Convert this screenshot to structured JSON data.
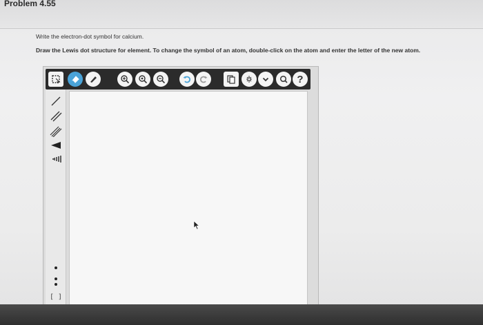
{
  "header": {
    "title": "Problem 4.55"
  },
  "question": {
    "line1": "Write the electron-dot symbol for calcium.",
    "line2": "Draw the Lewis dot structure for element. To change the symbol of an atom, double-click on the atom and enter the letter of the new atom."
  },
  "toolbar": {
    "items": [
      {
        "icon": "lasso-select-icon"
      },
      {
        "icon": "eraser-icon",
        "state": "active"
      },
      {
        "icon": "pen-icon"
      },
      {
        "icon": "zoom-in-icon"
      },
      {
        "icon": "zoom-fit-icon"
      },
      {
        "icon": "zoom-out-icon"
      },
      {
        "icon": "undo-icon"
      },
      {
        "icon": "redo-icon"
      },
      {
        "icon": "templates-icon"
      },
      {
        "icon": "settings-icon"
      },
      {
        "icon": "chevron-down-icon"
      },
      {
        "icon": "search-icon"
      },
      {
        "icon": "help-icon",
        "label": "?"
      }
    ]
  },
  "side_tools": [
    "single-bond-icon",
    "double-bond-icon",
    "triple-bond-icon",
    "wedge-bond-icon",
    "hash-bond-icon",
    "lone-electron-icon",
    "electron-pair-icon",
    "bracket-icon"
  ],
  "side_labels": {
    "bracket": "[ ]"
  },
  "colors": {
    "accent": "#4aa3d8",
    "toolbar": "#2b2b2b"
  }
}
